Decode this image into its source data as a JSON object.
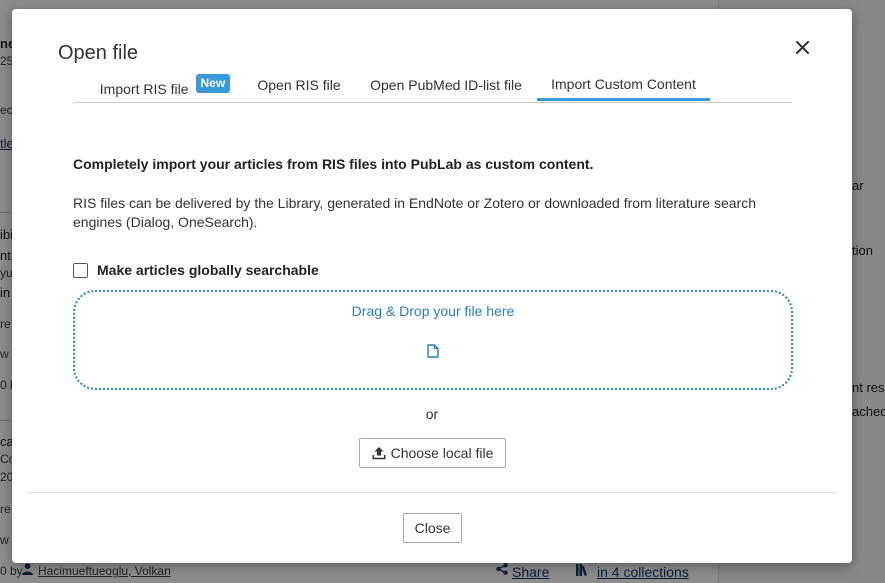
{
  "background": {
    "left_fragments": [
      "ne",
      "25",
      "ec",
      "tle",
      "ibi",
      "ntr",
      "yu",
      " in",
      "re a",
      "w",
      "0 b",
      "ca",
      " Co",
      "20-",
      "re a",
      "w"
    ],
    "footer_prefix": "0 by",
    "author": "Hacimueftueoglu, Volkan",
    "share_label": "Share",
    "collections_label": "in 4 collections",
    "right_fragments": [
      "ar",
      "tion",
      "nt res",
      "ached"
    ]
  },
  "modal": {
    "title": "Open file",
    "close_icon": "close-icon",
    "tabs": [
      {
        "label": "Import RIS file",
        "badge": "New",
        "active": false
      },
      {
        "label": "Open RIS file",
        "active": false
      },
      {
        "label": "Open PubMed ID-list file",
        "active": false
      },
      {
        "label": "Import Custom Content",
        "active": true
      }
    ],
    "lead": "Completely import your articles from RIS files into PubLab as custom content.",
    "description": "RIS files can be delivered by the Library, generated in EndNote or Zotero or downloaded from literature search engines (Dialog, OneSearch).",
    "checkbox": {
      "label": "Make articles globally searchable",
      "checked": false
    },
    "dropzone": {
      "label": "Drag & Drop your file here",
      "icon": "file-icon"
    },
    "or_text": "or",
    "choose_button": {
      "label": "Choose local file",
      "icon": "upload-icon"
    },
    "close_button": "Close",
    "colors": {
      "accent": "#3a9ad9",
      "link": "#2a7fb8"
    }
  }
}
